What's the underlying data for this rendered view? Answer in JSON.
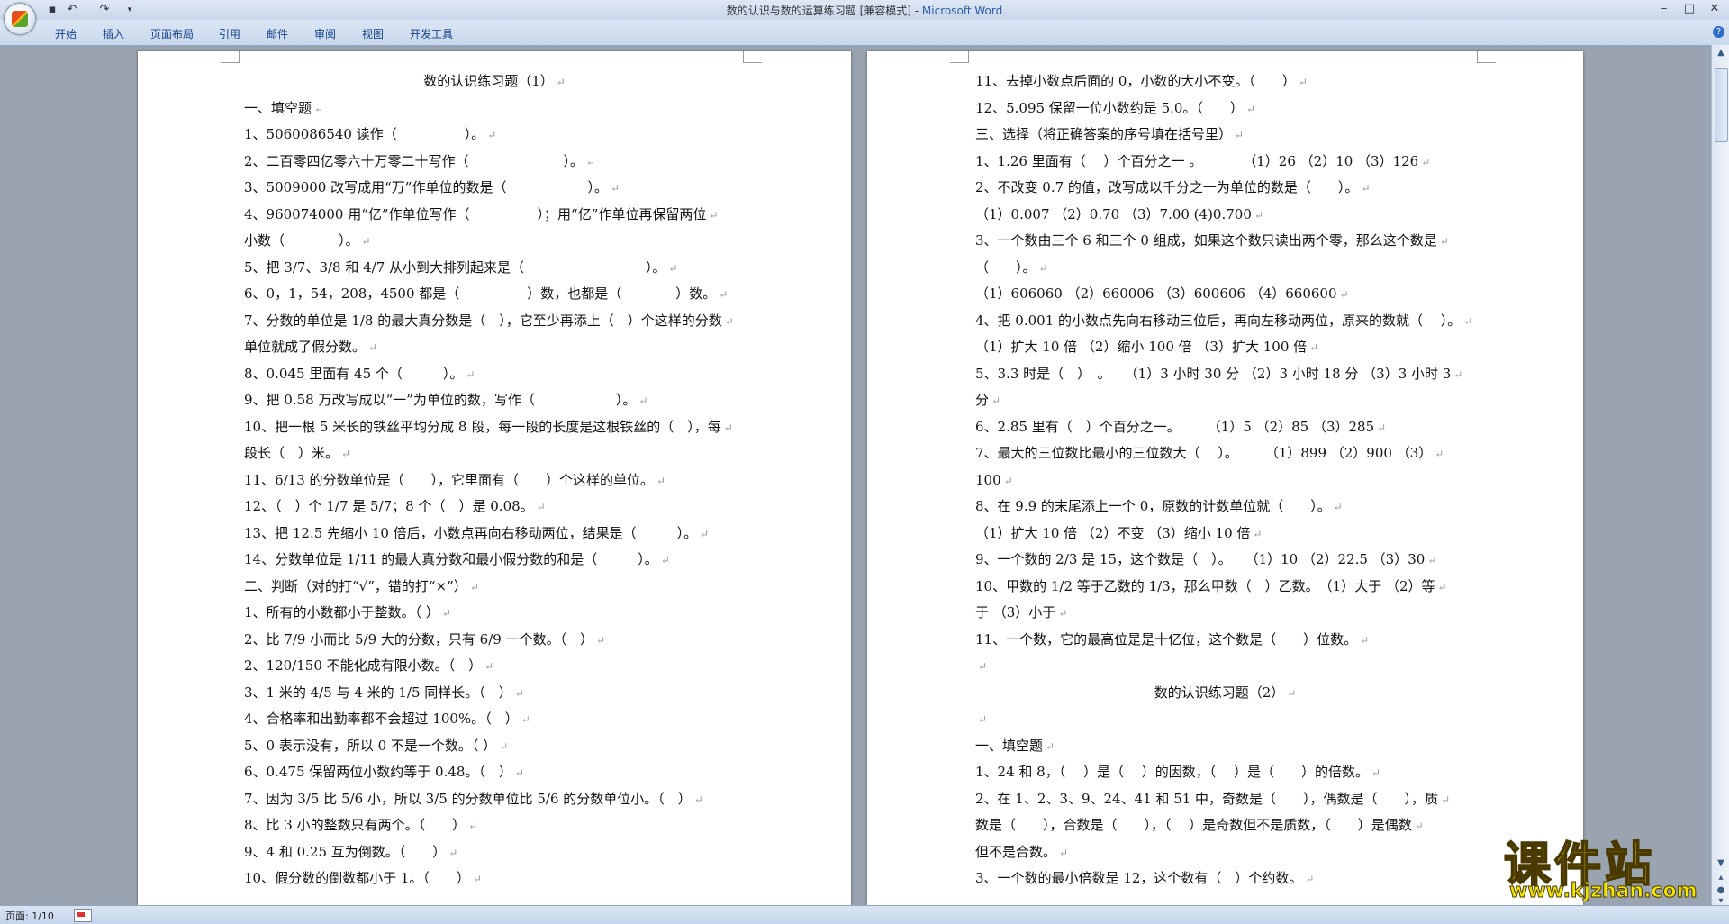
{
  "window": {
    "doc_title": "数的认识与数的运算练习题 [兼容模式] - ",
    "app_name": "Microsoft Word",
    "tabs": [
      "开始",
      "插入",
      "页面布局",
      "引用",
      "邮件",
      "审阅",
      "视图",
      "开发工具"
    ]
  },
  "status": {
    "page_count": "页面: 1/10"
  },
  "watermark": {
    "main": "课件站",
    "url": "www.kjzhan.com"
  },
  "page_left": [
    {
      "t": "数的认识练习题（1）",
      "center": true
    },
    {
      "t": "一、填空题"
    },
    {
      "t": "1、5060086540 读作（　　　　　）。"
    },
    {
      "t": "2、二百零四亿零六十万零二十写作（　　　　　　　）。"
    },
    {
      "t": "3、5009000 改写成用“万”作单位的数是（　　　　　　）。"
    },
    {
      "t": "4、960074000 用“亿”作单位写作（　　　　　）；用“亿”作单位再保留两位"
    },
    {
      "t": "小数（　　　　）。"
    },
    {
      "t": "5、把 3/7、3/8 和 4/7 从小到大排列起来是（　　　　　　　　　）。"
    },
    {
      "t": "6、0，1，54，208，4500 都是（　　　　　）数，也都是（　　　　）数。"
    },
    {
      "t": "7、分数的单位是 1/8 的最大真分数是（　），它至少再添上（　）个这样的分数"
    },
    {
      "t": "单位就成了假分数。"
    },
    {
      "t": "8、0.045 里面有 45 个（　　　）。"
    },
    {
      "t": "9、把 0.58 万改写成以“一”为单位的数，写作（　　　　　　）。"
    },
    {
      "t": "10、把一根 5 米长的铁丝平均分成 8 段，每一段的长度是这根铁丝的（　），每"
    },
    {
      "t": "段长（　）米。"
    },
    {
      "t": "11、6/13 的分数单位是（　　），它里面有（　　）个这样的单位。"
    },
    {
      "t": "12、（　）个 1/7 是 5/7；8 个（　）是 0.08。"
    },
    {
      "t": "13、把 12.5 先缩小 10 倍后，小数点再向右移动两位，结果是（　　　）。"
    },
    {
      "t": "14、分数单位是 1/11 的最大真分数和最小假分数的和是（　　　）。"
    },
    {
      "t": "二、判断（对的打“√”，错的打“×”）"
    },
    {
      "t": "1、所有的小数都小于整数。（ ）"
    },
    {
      "t": "2、比 7/9 小而比 5/9 大的分数，只有 6/9 一个数。（　）"
    },
    {
      "t": "2、120/150 不能化成有限小数。（　）"
    },
    {
      "t": "3、1 米的 4/5 与 4 米的 1/5 同样长。（　）"
    },
    {
      "t": "4、合格率和出勤率都不会超过 100%。（　）"
    },
    {
      "t": "5、0 表示没有，所以 0 不是一个数。（ ）"
    },
    {
      "t": "6、0.475 保留两位小数约等于 0.48。（　）"
    },
    {
      "t": "7、因为 3/5 比 5/6 小，所以 3/5 的分数单位比 5/6 的分数单位小。（　）"
    },
    {
      "t": "8、比 3 小的整数只有两个。（　　）"
    },
    {
      "t": "9、4 和 0.25 互为倒数。（　　）"
    },
    {
      "t": "10、假分数的倒数都小于 1。（　　）"
    }
  ],
  "page_right": [
    {
      "t": "11、去掉小数点后面的 0，小数的大小不变。（　　）"
    },
    {
      "t": "12、5.095 保留一位小数约是 5.0。（　　）"
    },
    {
      "t": "三、选择（将正确答案的序号填在括号里）"
    },
    {
      "t": "1、1.26 里面有（　 ）个百分之一 。　　　　（1）26 （2）10 （3）126"
    },
    {
      "t": "2、不改变 0.7 的值，改写成以千分之一为单位的数是（　　）。"
    },
    {
      "t": "（1）0.007 （2）0.70 （3）7.00 (4)0.700"
    },
    {
      "t": "3、一个数由三个 6 和三个 0 组成，如果这个数只读出两个零，那么这个数是"
    },
    {
      "t": "（　　）。"
    },
    {
      "t": "（1）606060 （2）660006 （3）600606 （4）660600"
    },
    {
      "t": "4、把 0.001 的小数点先向右移动三位后，再向左移动两位，原来的数就（　 ）。"
    },
    {
      "t": "（1）扩大 10 倍 （2）缩小 100 倍 （3）扩大 100 倍"
    },
    {
      "t": "5、3.3 时是（　）　。　　（1）3 小时 30 分 （2）3 小时 18 分 （3）3 小时 3"
    },
    {
      "t": "分"
    },
    {
      "t": "6、2.85 里有（　）个百分之一。　　　（1）5 （2）85 （3）285"
    },
    {
      "t": "7、最大的三位数比最小的三位数大（　 ）。　　　（1）899 （2）900 （3）"
    },
    {
      "t": "100"
    },
    {
      "t": "8、在 9.9 的末尾添上一个 0，原数的计数单位就（　　）。"
    },
    {
      "t": "（1）扩大 10 倍 （2）不变 （3）缩小 10 倍"
    },
    {
      "t": "9、一个数的 2/3 是 15，这个数是（　）。　　（1）10 （2）22.5 （3）30"
    },
    {
      "t": "10、甲数的 1/2 等于乙数的 1/3，那么甲数（　）乙数。　（1）大于 （2）等"
    },
    {
      "t": "于 （3）小于"
    },
    {
      "t": "11、一个数，它的最高位是是十亿位，这个数是（　　）位数。"
    },
    {
      "t": ""
    },
    {
      "t": "数的认识练习题（2）",
      "center": true
    },
    {
      "t": ""
    },
    {
      "t": "一、填空题"
    },
    {
      "t": "1、24 和 8，（　 ）是（　 ）的因数，（　 ）是（　　）的倍数。"
    },
    {
      "t": "2、在 1、2、3、9、24、41 和 51 中，奇数是（　　），偶数是（　　），质"
    },
    {
      "t": "数是（　　），合数是（　　），（　 ）是奇数但不是质数，（　　）是偶数"
    },
    {
      "t": "但不是合数。"
    },
    {
      "t": "3、一个数的最小倍数是 12，这个数有（　）个约数。"
    }
  ]
}
